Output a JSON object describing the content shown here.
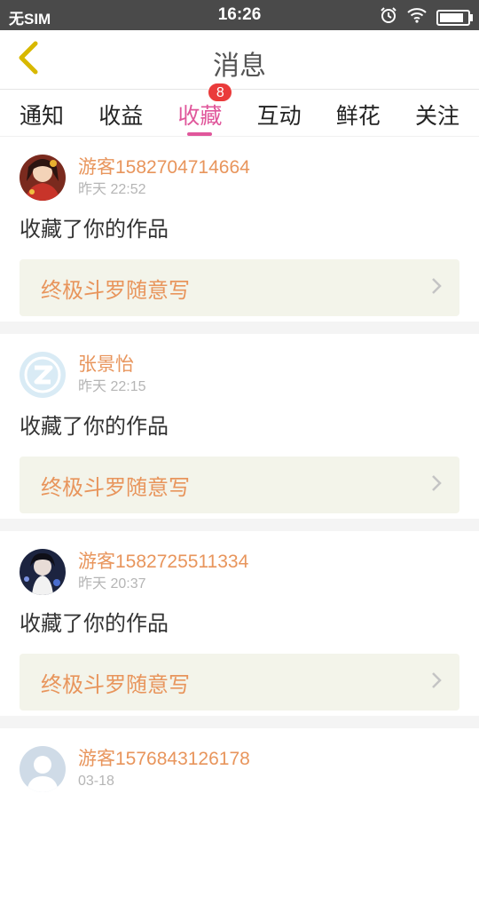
{
  "status_bar": {
    "carrier": "无SIM",
    "time": "16:26",
    "icons": [
      "alarm-icon",
      "wifi-icon",
      "battery-icon"
    ],
    "battery_level": 0.85
  },
  "header": {
    "title": "消息",
    "back_icon": "chevron-left-icon"
  },
  "tabs": [
    {
      "label": "通知"
    },
    {
      "label": "收益"
    },
    {
      "label": "收藏",
      "badge": "8",
      "active": true
    },
    {
      "label": "互动"
    },
    {
      "label": "鲜花"
    },
    {
      "label": "关注"
    }
  ],
  "messages": [
    {
      "name": "游客1582704714664",
      "time": "昨天 22:52",
      "action": "收藏了你的作品",
      "work_title": "终极斗罗随意写",
      "avatar": "anime-girl-red-avatar"
    },
    {
      "name": "张景怡",
      "time": "昨天 22:15",
      "action": "收藏了你的作品",
      "work_title": "终极斗罗随意写",
      "avatar": "default-logo-avatar"
    },
    {
      "name": "游客1582725511334",
      "time": "昨天 20:37",
      "action": "收藏了你的作品",
      "work_title": "终极斗罗随意写",
      "avatar": "anime-dark-avatar"
    },
    {
      "name": "游客1576843126178",
      "time": "03-18",
      "action": "",
      "work_title": "",
      "avatar": "default-person-avatar"
    }
  ],
  "colors": {
    "accent": "#e0579b",
    "name": "#e8955c",
    "badge": "#ea3b3b",
    "back_icon": "#e0c000"
  }
}
